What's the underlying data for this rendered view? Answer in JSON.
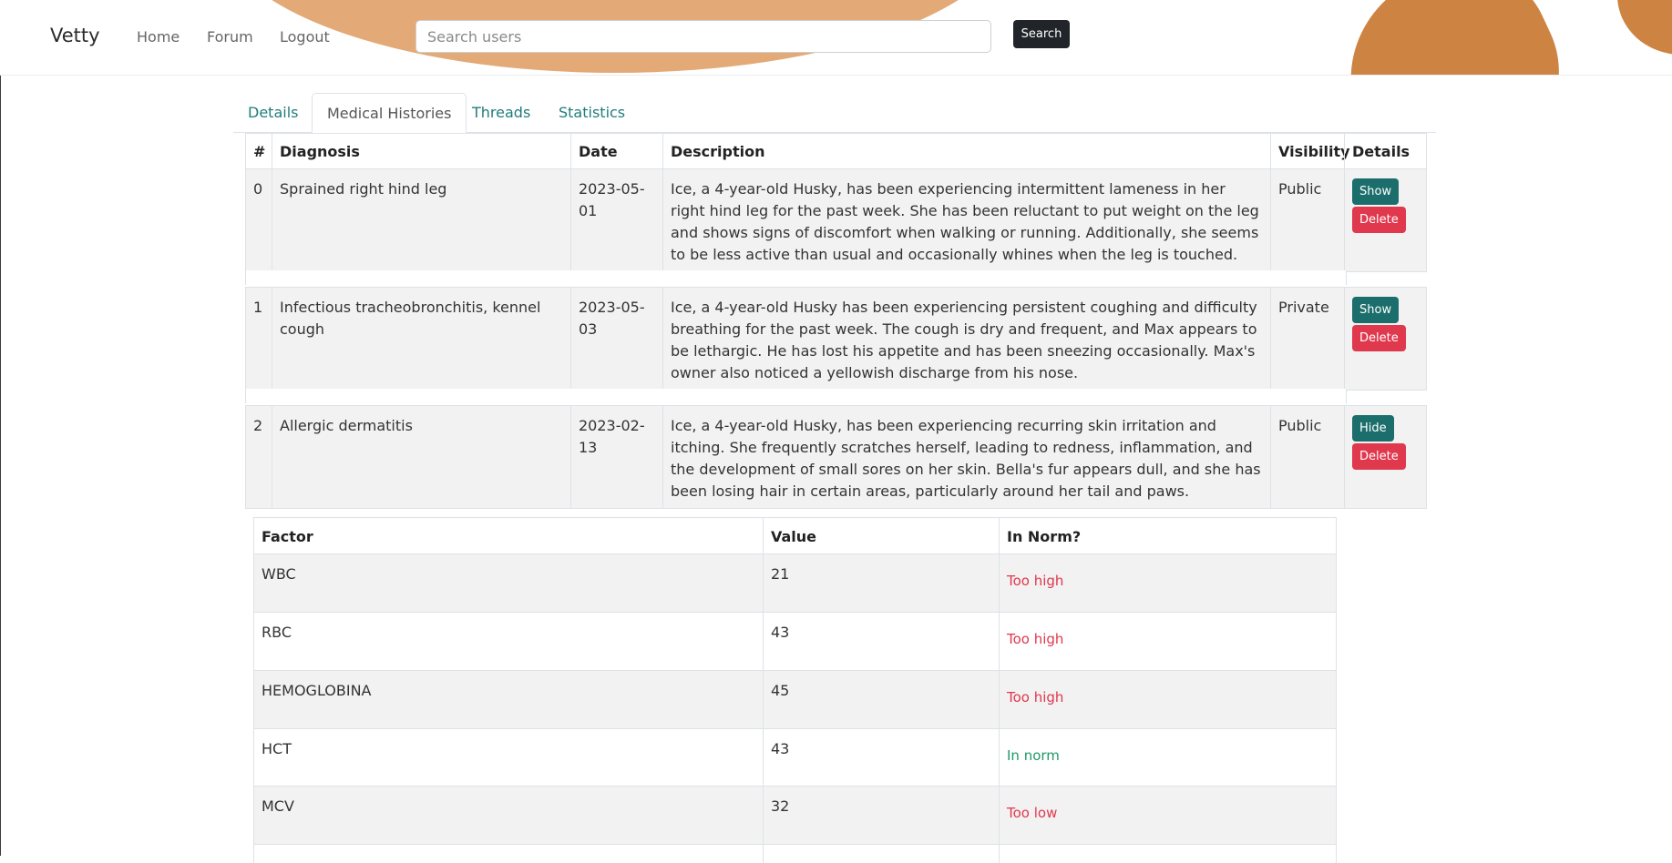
{
  "navbar": {
    "brand": "Vetty",
    "links": [
      "Home",
      "Forum",
      "Logout"
    ],
    "search_placeholder": "Search users",
    "search_value": "",
    "search_button": "Search"
  },
  "tabs": [
    {
      "label": "Details",
      "active": false
    },
    {
      "label": "Medical Histories",
      "active": true
    },
    {
      "label": "Threads",
      "active": false
    },
    {
      "label": "Statistics",
      "active": false
    }
  ],
  "histories_table": {
    "headers": [
      "#",
      "Diagnosis",
      "Date",
      "Description",
      "Visibility",
      "Details"
    ],
    "rows": [
      {
        "num": "0",
        "diagnosis": "Sprained right hind leg",
        "date": "2023-05-01",
        "description": "Ice, a 4-year-old Husky, has been experiencing intermittent lameness in her right hind leg for the past week. She has been reluctant to put weight on the leg and shows signs of discomfort when walking or running. Additionally, she seems to be less active than usual and occasionally whines when the leg is touched.",
        "visibility": "Public",
        "toggle_label": "Show",
        "delete_label": "Delete"
      },
      {
        "num": "1",
        "diagnosis": "Infectious tracheobronchitis, kennel cough",
        "date": "2023-05-03",
        "description": "Ice, a 4-year-old Husky has been experiencing persistent coughing and difficulty breathing for the past week. The cough is dry and frequent, and Max appears to be lethargic. He has lost his appetite and has been sneezing occasionally. Max's owner also noticed a yellowish discharge from his nose.",
        "visibility": "Private",
        "toggle_label": "Show",
        "delete_label": "Delete"
      },
      {
        "num": "2",
        "diagnosis": "Allergic dermatitis",
        "date": "2023-02-13",
        "description": "Ice, a 4-year-old Husky, has been experiencing recurring skin irritation and itching. She frequently scratches herself, leading to redness, inflammation, and the development of small sores on her skin. Bella's fur appears dull, and she has been losing hair in certain areas, particularly around her tail and paws.",
        "visibility": "Public",
        "toggle_label": "Hide",
        "delete_label": "Delete"
      }
    ]
  },
  "factors_table": {
    "headers": [
      "Factor",
      "Value",
      "In Norm?"
    ],
    "rows": [
      {
        "factor": "WBC",
        "value": "21",
        "norm": "Too high",
        "status": "high"
      },
      {
        "factor": "RBC",
        "value": "43",
        "norm": "Too high",
        "status": "high"
      },
      {
        "factor": "HEMOGLOBINA",
        "value": "45",
        "norm": "Too high",
        "status": "high"
      },
      {
        "factor": "HCT",
        "value": "43",
        "norm": "In norm",
        "status": "ok"
      },
      {
        "factor": "MCV",
        "value": "32",
        "norm": "Too low",
        "status": "low"
      }
    ]
  },
  "colors": {
    "accent_teal": "#1c6e6c",
    "link_teal": "#1f7d7b",
    "danger": "#e0384d",
    "success": "#1e9a66",
    "blob_light": "#e3a976",
    "blob_dark": "#cd8443"
  }
}
